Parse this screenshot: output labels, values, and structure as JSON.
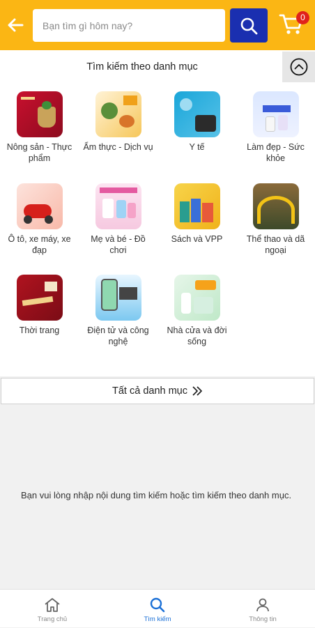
{
  "header": {
    "search_placeholder": "Bạn tìm gì hôm nay?",
    "cart_count": "0",
    "accent_color": "#fbb614",
    "search_button_color": "#1a2fb0"
  },
  "categories_section": {
    "title": "Tìm kiếm theo danh mục",
    "items": [
      {
        "label": "Nông sản - Thực phẩm",
        "icon": "agriculture-food-thumb"
      },
      {
        "label": "Ẩm thực - Dịch vụ",
        "icon": "cuisine-services-thumb"
      },
      {
        "label": "Y tế",
        "icon": "healthcare-thumb"
      },
      {
        "label": "Làm đẹp - Sức khỏe",
        "icon": "beauty-health-thumb"
      },
      {
        "label": "Ô tô, xe máy, xe đạp",
        "icon": "vehicles-thumb"
      },
      {
        "label": "Mẹ và bé - Đồ chơi",
        "icon": "mother-baby-toys-thumb"
      },
      {
        "label": "Sách và VPP",
        "icon": "books-stationery-thumb"
      },
      {
        "label": "Thể thao và dã ngoại",
        "icon": "sports-outdoor-thumb"
      },
      {
        "label": "Thời trang",
        "icon": "fashion-thumb"
      },
      {
        "label": "Điện tử và công nghệ",
        "icon": "electronics-tech-thumb"
      },
      {
        "label": "Nhà cửa và đời sống",
        "icon": "home-living-thumb"
      }
    ],
    "all_categories_label": "Tất cả danh mục"
  },
  "empty_state": {
    "message": "Bạn vui lòng nhập nội dung tìm kiếm hoặc tìm kiếm theo danh mục."
  },
  "bottom_nav": {
    "items": [
      {
        "label": "Trang chủ",
        "icon": "home-icon"
      },
      {
        "label": "Tìm kiếm",
        "icon": "search-icon",
        "active": true
      },
      {
        "label": "Thông tin",
        "icon": "user-icon"
      }
    ],
    "active_color": "#1a6fd6"
  }
}
